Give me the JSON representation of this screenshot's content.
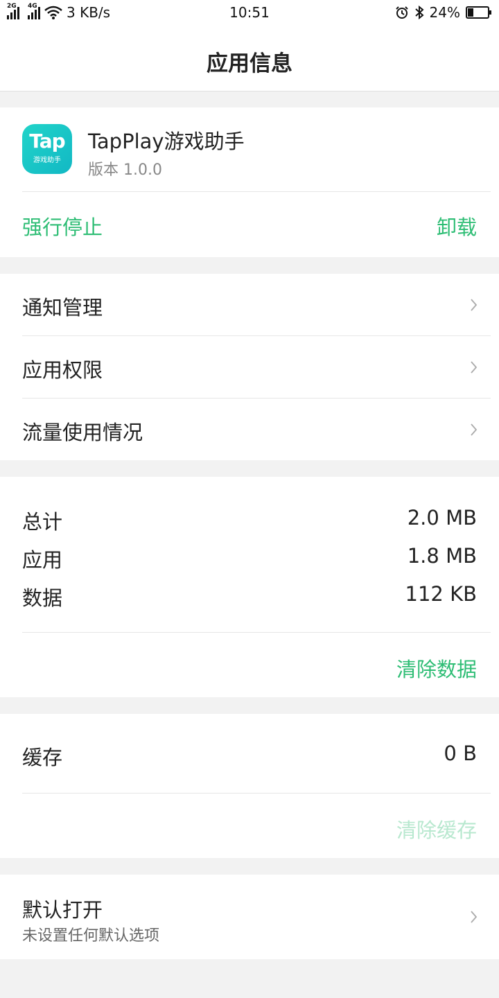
{
  "status_bar": {
    "sim1_tag": "2G",
    "sim2_tag": "4G",
    "net_speed": "3 KB/s",
    "time": "10:51",
    "battery": "24%",
    "icons": [
      "signal-icon",
      "wifi-icon",
      "alarm-icon",
      "bluetooth-icon",
      "battery-icon"
    ]
  },
  "header": {
    "title": "应用信息"
  },
  "app": {
    "icon_text": "Tap",
    "icon_subtext": "游戏助手",
    "name": "TapPlay游戏助手",
    "version": "版本 1.0.0",
    "force_stop": "强行停止",
    "uninstall": "卸载"
  },
  "menu": {
    "items": [
      {
        "label": "通知管理"
      },
      {
        "label": "应用权限"
      },
      {
        "label": "流量使用情况"
      }
    ]
  },
  "storage": {
    "rows": [
      {
        "label": "总计",
        "value": "2.0 MB"
      },
      {
        "label": "应用",
        "value": "1.8 MB"
      },
      {
        "label": "数据",
        "value": "112 KB"
      }
    ],
    "clear_data": "清除数据"
  },
  "cache": {
    "label": "缓存",
    "value": "0 B",
    "clear_cache": "清除缓存"
  },
  "default_open": {
    "label": "默认打开",
    "subtitle": "未设置任何默认选项"
  },
  "colors": {
    "accent_green": "#2dbd74",
    "disabled_green": "#b8e8cf",
    "app_icon": "#1cc8c8"
  }
}
